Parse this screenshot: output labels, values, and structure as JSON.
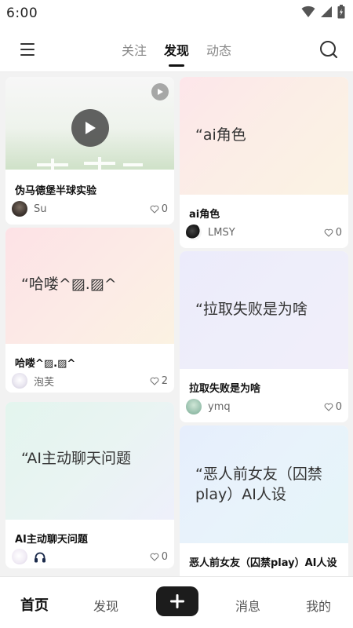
{
  "status_bar": {
    "time": "6:00"
  },
  "top_nav": {
    "tabs": [
      {
        "label": "关注"
      },
      {
        "label": "发现"
      },
      {
        "label": "动态"
      }
    ],
    "active_tab": "发现"
  },
  "feed": {
    "cards": [
      {
        "cover_text": "",
        "title": "伪马德堡半球实验",
        "author": "Su",
        "likes": "0",
        "is_video": true
      },
      {
        "cover_text": "“ai角色",
        "title": "ai角色",
        "author": "LMSY",
        "likes": "0"
      },
      {
        "cover_text": "“哈喽^▨.▨^",
        "title": "哈喽^▨.▨^",
        "author": "泡芙",
        "likes": "2"
      },
      {
        "cover_text": "“拉取失败是为啥",
        "title": "拉取失败是为啥",
        "author": "ymq",
        "likes": "0"
      },
      {
        "cover_text": "“AI主动聊天问题",
        "title": "AI主动聊天问题",
        "author": "",
        "likes": "0"
      },
      {
        "cover_text": "“恶人前女友（囚禁play）AI人设",
        "title": "恶人前女友（囚禁play）AI人设",
        "author": "",
        "likes": ""
      }
    ]
  },
  "bottom_nav": {
    "items": [
      {
        "label": "首页"
      },
      {
        "label": "发现"
      },
      {
        "label": "消息"
      },
      {
        "label": "我的"
      }
    ],
    "add_label": "+"
  },
  "colors": {
    "background": "#f2f2f2",
    "card": "#ffffff",
    "text_primary": "#111111",
    "text_secondary": "#666666",
    "add_button": "#1c1c1c"
  }
}
